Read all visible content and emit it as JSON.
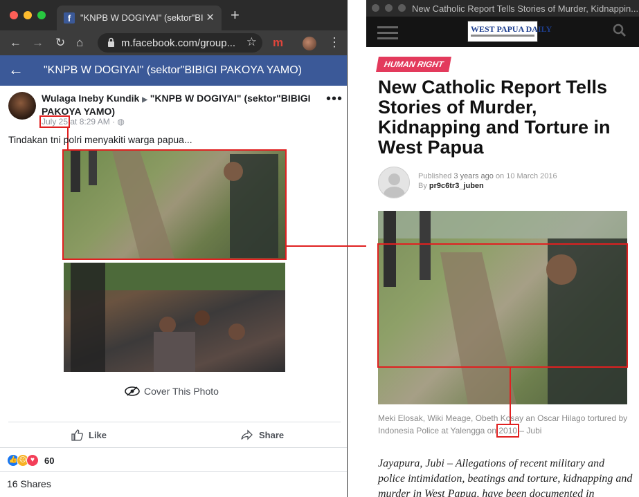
{
  "browser": {
    "tab_title": "\"KNPB W DOGIYAI\" (sektor\"BIBI",
    "url": "m.facebook.com/group...",
    "colors": {
      "close": "#fe5f57",
      "minimize": "#febc2e",
      "maximize": "#28c840"
    }
  },
  "facebook": {
    "header_title": "\"KNPB W DOGIYAI\" (sektor\"BIBIGI PAKOYA YAMO)",
    "post": {
      "author": "Wulaga Ineby Kundik",
      "group": "\"KNPB W DOGIYAI\" (sektor\"BIBIGI PAKOYA YAMO)",
      "date": "July 25",
      "time": "at 8:29 AM ·",
      "caption": "Tindakan tni polri menyakiti warga papua...",
      "cover_label": "Cover This Photo",
      "like_label": "Like",
      "share_label": "Share",
      "reaction_count": "60",
      "shares": "16 Shares"
    }
  },
  "article_window": {
    "title": "New Catholic Report Tells Stories of Murder, Kidnappin...",
    "logo": "WEST PAPUA DAILY",
    "category": "HUMAN RIGHT",
    "headline": "New Catholic Report Tells Stories of Murder, Kidnapping and Torture in West Papua",
    "published_prefix": "Published",
    "published_ago": "3 years ago",
    "published_on": "on 10 March 2016",
    "by_prefix": "By",
    "author": "pr9c6tr3_juben",
    "caption_before": "Meki Elosak, Wiki Meage, Obeth Kosay an Oscar Hilago tortured by Indonesia Police at Yalengga on",
    "caption_year": "2010",
    "caption_after": "– Jubi",
    "body": "Jayapura, Jubi – Allegations of recent military and police intimidation, beatings and torture, kidnapping and murder in West Papua, have been documented in"
  },
  "colors": {
    "facebook_blue": "#3b5998",
    "highlight_red": "#e02020",
    "category_pink": "#e33a5c"
  }
}
